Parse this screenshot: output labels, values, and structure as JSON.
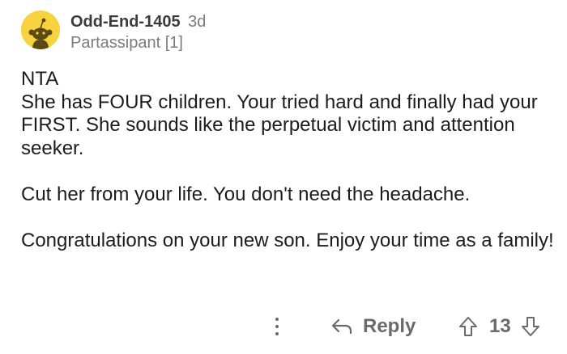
{
  "comment": {
    "username": "Odd-End-1405",
    "time": "3d",
    "flair": "Partassipant [1]",
    "body": {
      "line1": "NTA",
      "paragraph1": "She has FOUR children.  Your tried hard and finally had your FIRST.  She sounds like the perpetual victim and attention seeker.",
      "paragraph2": "Cut her from your life.  You don't need the headache.",
      "paragraph3": "Congratulations on your new son.  Enjoy your time as a family!"
    }
  },
  "actions": {
    "more_icon": "more-vertical-icon",
    "reply_icon": "reply-arrow-icon",
    "reply_label": "Reply",
    "upvote_icon": "upvote-arrow-icon",
    "vote_count": "13",
    "downvote_icon": "downvote-arrow-icon"
  },
  "colors": {
    "avatar_bg": "#f7d33f",
    "text_primary": "#1c1c1c",
    "text_muted": "#7c7c7c",
    "icon_gray": "#6b6b6b"
  }
}
